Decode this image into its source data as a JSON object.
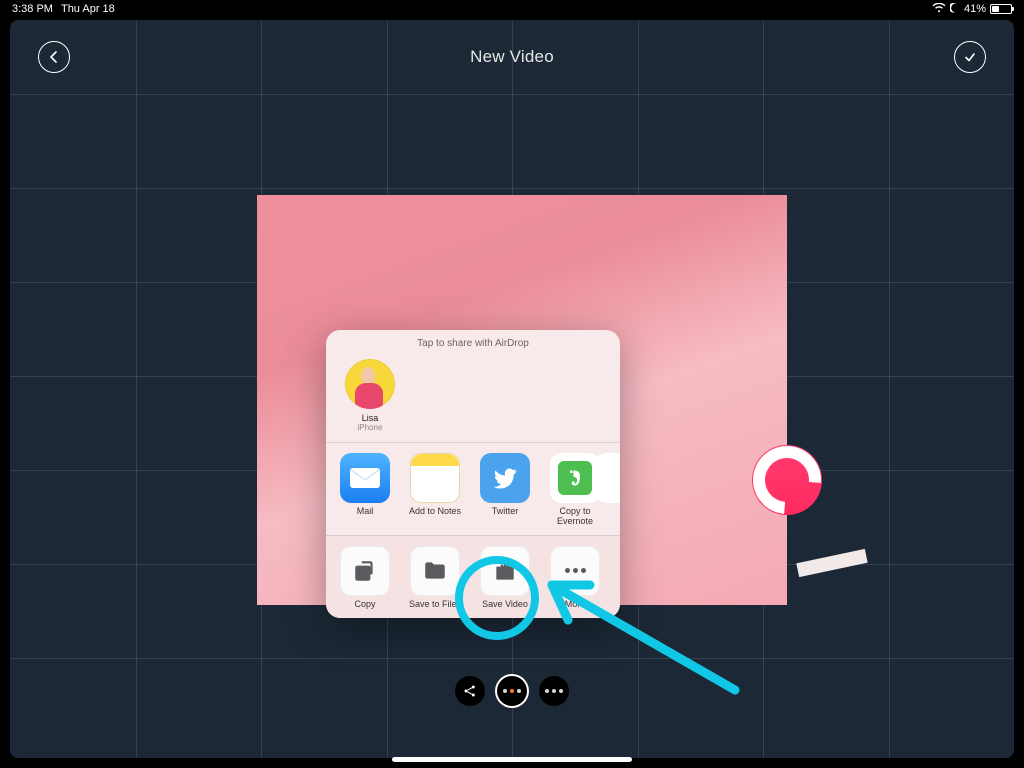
{
  "status": {
    "time": "3:38 PM",
    "date": "Thu Apr 18",
    "battery_pct": "41%",
    "battery_fill_pct": 41
  },
  "header": {
    "title": "New Video"
  },
  "share": {
    "header": "Tap to share with AirDrop",
    "airdrop": {
      "name": "Lisa",
      "device": "iPhone"
    },
    "apps": [
      {
        "label": "Mail"
      },
      {
        "label": "Add to Notes"
      },
      {
        "label": "Twitter"
      },
      {
        "label": "Copy to Evernote"
      }
    ],
    "actions": [
      {
        "label": "Copy"
      },
      {
        "label": "Save to Files"
      },
      {
        "label": "Save Video"
      },
      {
        "label": "More"
      }
    ]
  }
}
